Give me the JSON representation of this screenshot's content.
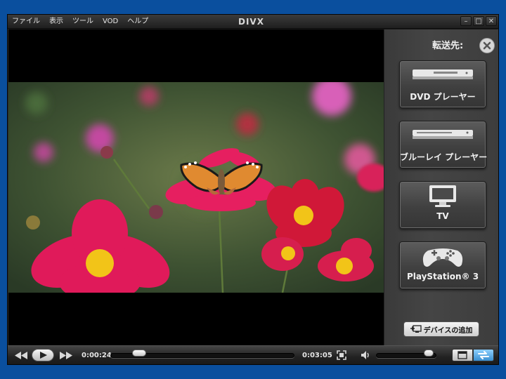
{
  "menu": {
    "items": [
      "ファイル",
      "表示",
      "ツール",
      "VOD",
      "ヘルプ"
    ]
  },
  "title": {
    "logo": "DIVX"
  },
  "window_controls": {
    "minimize": "–",
    "maximize": "□",
    "close": "✕"
  },
  "panel": {
    "header": "転送先:",
    "devices": [
      {
        "label": "DVD プレーヤー",
        "icon": "dvd-player-icon"
      },
      {
        "label": "ブルーレイ プレーヤー",
        "icon": "bluray-player-icon"
      },
      {
        "label": "TV",
        "icon": "tv-icon"
      },
      {
        "label": "PlayStation® 3",
        "icon": "gamepad-icon"
      }
    ],
    "add_device_label": "デバイスの追加"
  },
  "playback": {
    "current_time": "0:00:24",
    "total_time": "0:03:05",
    "progress_fraction": 0.13,
    "volume_fraction": 0.95
  },
  "colors": {
    "background": "#0a4f9e",
    "panel": "#404040",
    "accent_blue": "#4aa3e0"
  }
}
